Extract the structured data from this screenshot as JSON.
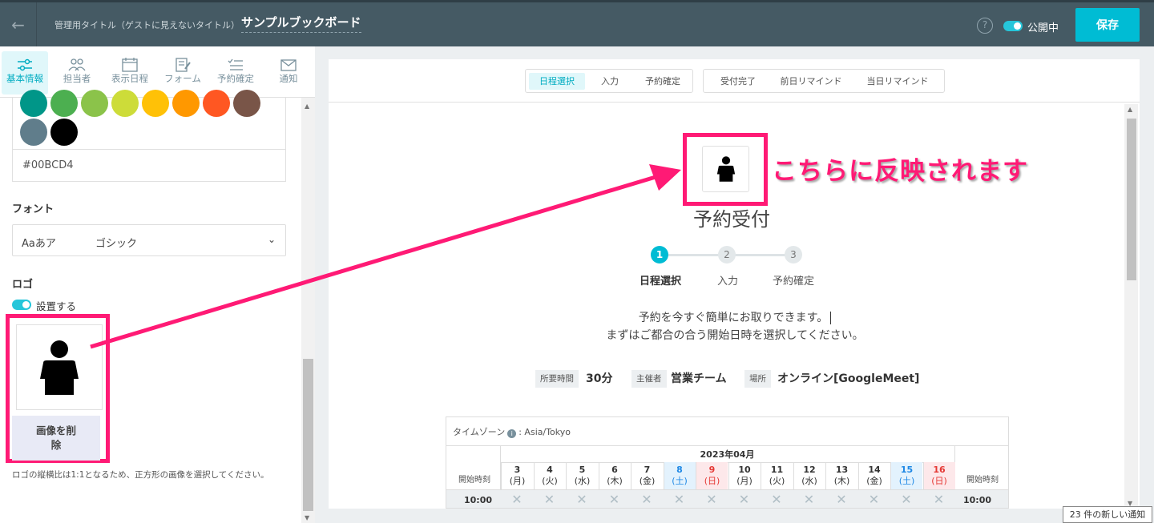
{
  "header": {
    "back_icon": "arrow-left-icon",
    "subtitle": "管理用タイトル（ゲストに見えないタイトル）",
    "title": "サンプルブックボード",
    "help": "?",
    "publish_label": "公開中",
    "save_label": "保存"
  },
  "tabs": [
    {
      "label": "基本情報",
      "icon": "sliders-icon"
    },
    {
      "label": "担当者",
      "icon": "people-icon"
    },
    {
      "label": "表示日程",
      "icon": "calendar-icon"
    },
    {
      "label": "フォーム",
      "icon": "form-edit-icon"
    },
    {
      "label": "予約確定",
      "icon": "list-check-icon"
    },
    {
      "label": "通知",
      "icon": "mail-icon"
    }
  ],
  "colors": {
    "swatches": [
      "#009688",
      "#4caf50",
      "#8bc34a",
      "#cddc39",
      "#ffc107",
      "#ff9800",
      "#ff5722",
      "#795548",
      "#607d8b",
      "#000000"
    ],
    "hex_value": "#00BCD4",
    "accent": "#00BCD4",
    "annotation": "#FF1A75"
  },
  "font": {
    "label": "フォント",
    "sample": "Aaあア",
    "value": "ゴシック"
  },
  "logo": {
    "label": "ロゴ",
    "toggle_label": "設置する",
    "delete_label_1": "画像を削",
    "delete_label_2": "除",
    "note": "ロゴの縦横比は1:1となるため、正方形の画像を選択してください。"
  },
  "preview": {
    "step_tabs_a": [
      "日程選択",
      "入力",
      "予約確定"
    ],
    "step_tabs_b": [
      "受付完了",
      "前日リマインド",
      "当日リマインド"
    ],
    "annotation": "こちらに反映されます",
    "title": "予約受付",
    "steps": [
      {
        "num": "1",
        "label": "日程選択"
      },
      {
        "num": "2",
        "label": "入力"
      },
      {
        "num": "3",
        "label": "予約確定"
      }
    ],
    "message_1": "予約を今すぐ簡単にお取りできます。",
    "message_2": "まずはご都合の合う開始日時を選択してください。",
    "info": [
      {
        "label": "所要時間",
        "value": "30分"
      },
      {
        "label": "主催者",
        "value": "営業チーム"
      },
      {
        "label": "場所",
        "value": "オンライン[GoogleMeet]"
      }
    ],
    "calendar": {
      "timezone_label": "タイムゾーン",
      "timezone_value": ": Asia/Tokyo",
      "month": "2023年04月",
      "start_time_label": "開始時刻",
      "days": [
        {
          "d": "3",
          "w": "(月)",
          "k": ""
        },
        {
          "d": "4",
          "w": "(火)",
          "k": ""
        },
        {
          "d": "5",
          "w": "(水)",
          "k": ""
        },
        {
          "d": "6",
          "w": "(木)",
          "k": ""
        },
        {
          "d": "7",
          "w": "(金)",
          "k": ""
        },
        {
          "d": "8",
          "w": "(土)",
          "k": "sat"
        },
        {
          "d": "9",
          "w": "(日)",
          "k": "sun"
        },
        {
          "d": "10",
          "w": "(月)",
          "k": ""
        },
        {
          "d": "11",
          "w": "(火)",
          "k": ""
        },
        {
          "d": "12",
          "w": "(水)",
          "k": ""
        },
        {
          "d": "13",
          "w": "(木)",
          "k": ""
        },
        {
          "d": "14",
          "w": "(金)",
          "k": ""
        },
        {
          "d": "15",
          "w": "(土)",
          "k": "sat"
        },
        {
          "d": "16",
          "w": "(日)",
          "k": "sun"
        }
      ],
      "first_time": "10:00",
      "unavailable_mark": "✕"
    }
  },
  "notification": "23 件の新しい通知"
}
